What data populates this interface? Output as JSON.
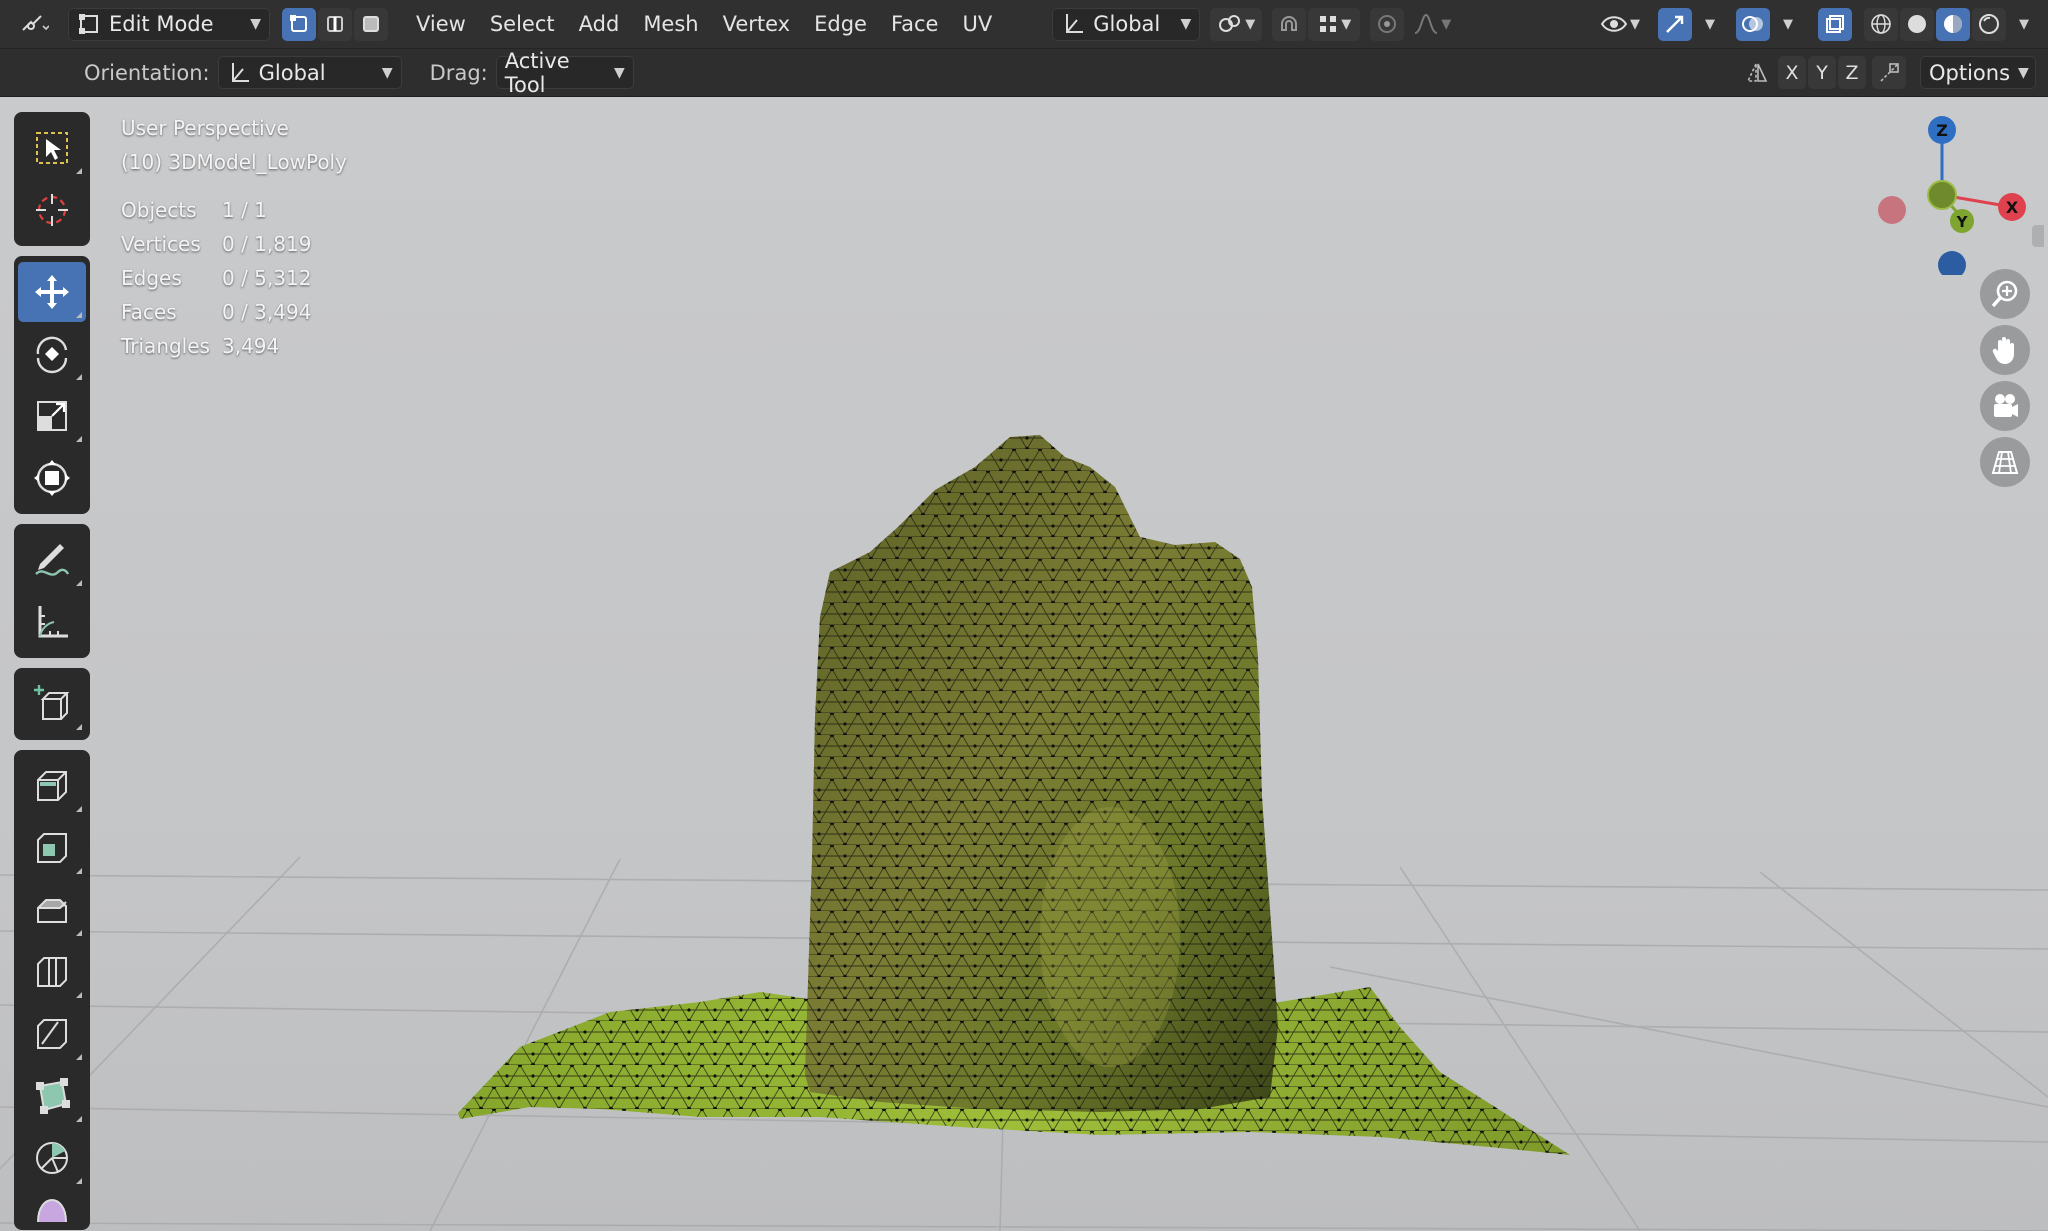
{
  "header": {
    "mode": "Edit Mode",
    "menus": [
      "View",
      "Select",
      "Add",
      "Mesh",
      "Vertex",
      "Edge",
      "Face",
      "UV"
    ],
    "transform_orientation": "Global"
  },
  "tool_settings": {
    "orientation_label": "Orientation:",
    "orientation_value": "Global",
    "drag_label": "Drag:",
    "drag_value": "Active Tool",
    "axis_x": "X",
    "axis_y": "Y",
    "axis_z": "Z",
    "options": "Options"
  },
  "overlay": {
    "view_name": "User Perspective",
    "object_name": "(10) 3DModel_LowPoly",
    "stats": [
      {
        "key": "Objects",
        "value": "1 / 1"
      },
      {
        "key": "Vertices",
        "value": "0 / 1,819"
      },
      {
        "key": "Edges",
        "value": "0 / 5,312"
      },
      {
        "key": "Faces",
        "value": "0 / 3,494"
      },
      {
        "key": "Triangles",
        "value": "3,494"
      }
    ]
  },
  "gizmo": {
    "x": "X",
    "y": "Y",
    "z": "Z"
  },
  "colors": {
    "active": "#4772b3",
    "axis_x": "#e0414e",
    "axis_y": "#7fa531",
    "axis_z": "#2e6fc4",
    "viewport_bg": "#c4c5c7"
  },
  "icons": {
    "toolbar": [
      "select-box-icon",
      "cursor-icon",
      "move-icon",
      "rotate-icon",
      "scale-icon",
      "transform-icon",
      "annotate-icon",
      "measure-icon",
      "add-cube-icon",
      "extrude-icon",
      "inset-icon",
      "bevel-icon",
      "loop-cut-icon",
      "knife-icon",
      "poly-build-icon",
      "spin-icon",
      "smooth-icon"
    ],
    "nav": [
      "zoom-icon",
      "hand-pan-icon",
      "camera-icon",
      "ortho-grid-icon"
    ]
  }
}
